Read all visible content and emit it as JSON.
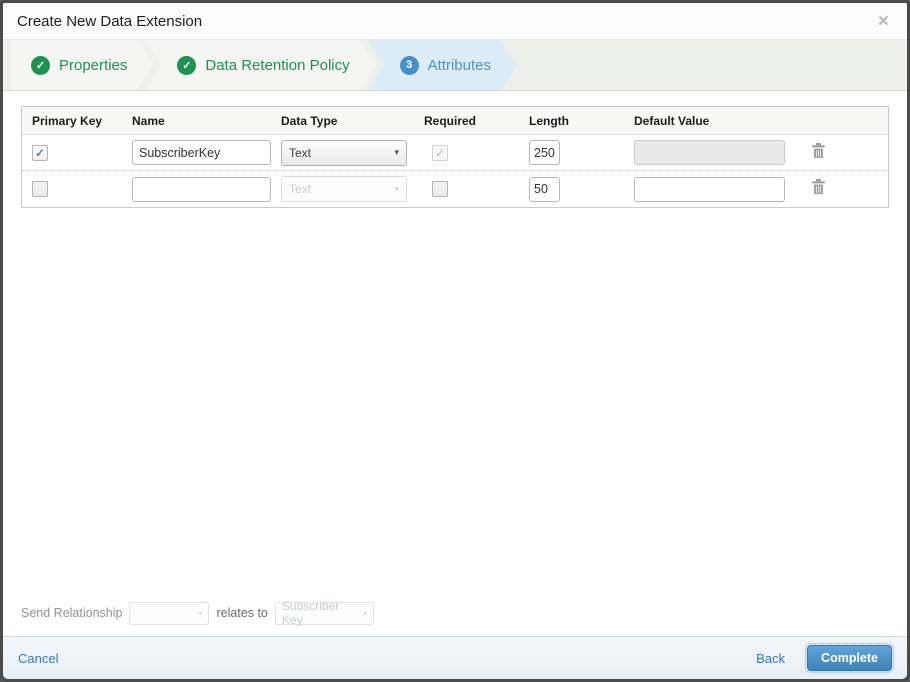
{
  "modal": {
    "title": "Create New Data Extension"
  },
  "icons": {
    "close": "×",
    "check": "✓",
    "dropdown_arrow": "▾",
    "trash": "trash-can"
  },
  "wizard": {
    "steps": [
      {
        "label": "Properties",
        "status": "complete"
      },
      {
        "label": "Data Retention Policy",
        "status": "complete"
      },
      {
        "label": "Attributes",
        "status": "active",
        "number": "3"
      }
    ]
  },
  "table": {
    "headers": [
      "Primary Key",
      "Name",
      "Data Type",
      "Required",
      "Length",
      "Default Value"
    ],
    "rows": [
      {
        "primary_key_checked": true,
        "name": "SubscriberKey",
        "data_type": "Text",
        "data_type_disabled": false,
        "required_checked": true,
        "required_disabled": true,
        "length": "250",
        "default_value": "",
        "default_value_disabled": true
      },
      {
        "primary_key_checked": false,
        "name": "",
        "data_type": "Text",
        "data_type_disabled": true,
        "required_checked": false,
        "required_disabled": false,
        "length": "50",
        "default_value": "",
        "default_value_disabled": false
      }
    ]
  },
  "send_relationship": {
    "label": "Send Relationship",
    "field_value": "",
    "relates_to_label": "relates to",
    "relates_to_value": "Subscriber Key"
  },
  "footer": {
    "cancel_label": "Cancel",
    "back_label": "Back",
    "complete_label": "Complete"
  },
  "colors": {
    "step_complete_green": "#1f9150",
    "step_active_blue": "#4a94ca",
    "step_active_bg": "#dcedf8",
    "link_blue": "#3179b8",
    "primary_button_blue": "#4183bb",
    "checkbox_check_blue": "#3b8dc8"
  }
}
